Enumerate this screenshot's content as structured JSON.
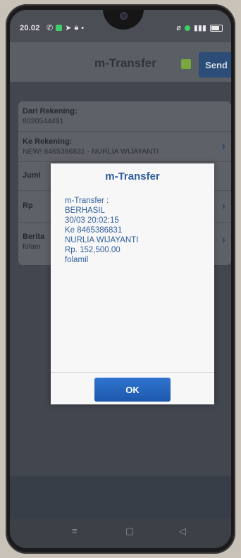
{
  "status_bar": {
    "time": "20.02",
    "left_icons": [
      "whatsapp-icon",
      "app-icon",
      "send-icon",
      "lock-icon",
      "dot-icon"
    ],
    "right_icons": [
      "silent-icon",
      "green-dot-icon",
      "signal-icon",
      "battery-icon"
    ]
  },
  "header": {
    "title": "m-Transfer",
    "send_label": "Send",
    "indicator_color": "#7aa63f"
  },
  "form": {
    "rows": [
      {
        "label": "Dari Rekening:",
        "value": "8020544491"
      },
      {
        "label": "Ke Rekening:",
        "value": "NEW! 8465386831 - NURLIA WIJAYANTI"
      },
      {
        "label": "Juml",
        "value": ""
      },
      {
        "label": "Rp",
        "value": ""
      },
      {
        "label": "Berita",
        "value": "folam"
      }
    ]
  },
  "dialog": {
    "title": "m-Transfer",
    "lines": [
      "m-Transfer :",
      "BERHASIL",
      "30/03 20:02:15",
      "Ke 8465386831",
      "NURLIA WIJAYANTI",
      "Rp. 152,500.00",
      "folamil"
    ],
    "ok_label": "OK"
  },
  "navbar": {
    "menu_icon": "≡",
    "home_icon": "▢",
    "back_icon": "◁"
  }
}
